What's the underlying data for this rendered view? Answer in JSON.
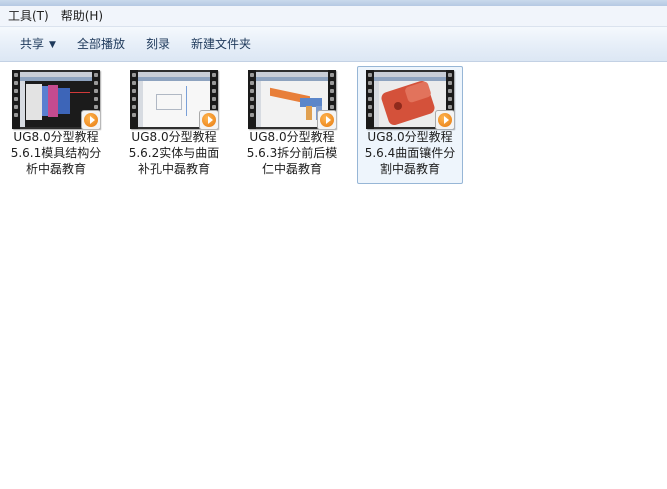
{
  "menu": [
    {
      "label": "工具(T)",
      "name": "menu-tools"
    },
    {
      "label": "帮助(H)",
      "name": "menu-help"
    }
  ],
  "toolbar": {
    "share_label": "共享",
    "play_all_label": "全部播放",
    "burn_label": "刻录",
    "new_folder_label": "新建文件夹"
  },
  "files": [
    {
      "lines": [
        "UG8.0分型教程",
        "5.6.1模具结构分",
        "析中磊教育"
      ],
      "selected": false,
      "thumbnail": "mold-structure-scene"
    },
    {
      "lines": [
        "UG8.0分型教程",
        "5.6.2实体与曲面",
        "补孔中磊教育"
      ],
      "selected": false,
      "thumbnail": "white-cad-workspace"
    },
    {
      "lines": [
        "UG8.0分型教程",
        "5.6.3拆分前后模",
        "仁中磊教育"
      ],
      "selected": false,
      "thumbnail": "orange-blue-part-scene"
    },
    {
      "lines": [
        "UG8.0分型教程",
        "5.6.4曲面镶件分",
        "割中磊教育"
      ],
      "selected": true,
      "thumbnail": "red-insert-part-scene"
    }
  ],
  "icons": {
    "dropdown": "dropdown-arrow-icon",
    "play": "video-play-badge-icon"
  },
  "colors": {
    "toolbar_text": "#1e395b",
    "selection_bg": "#eef5fc",
    "selection_border": "#97b6d6"
  }
}
